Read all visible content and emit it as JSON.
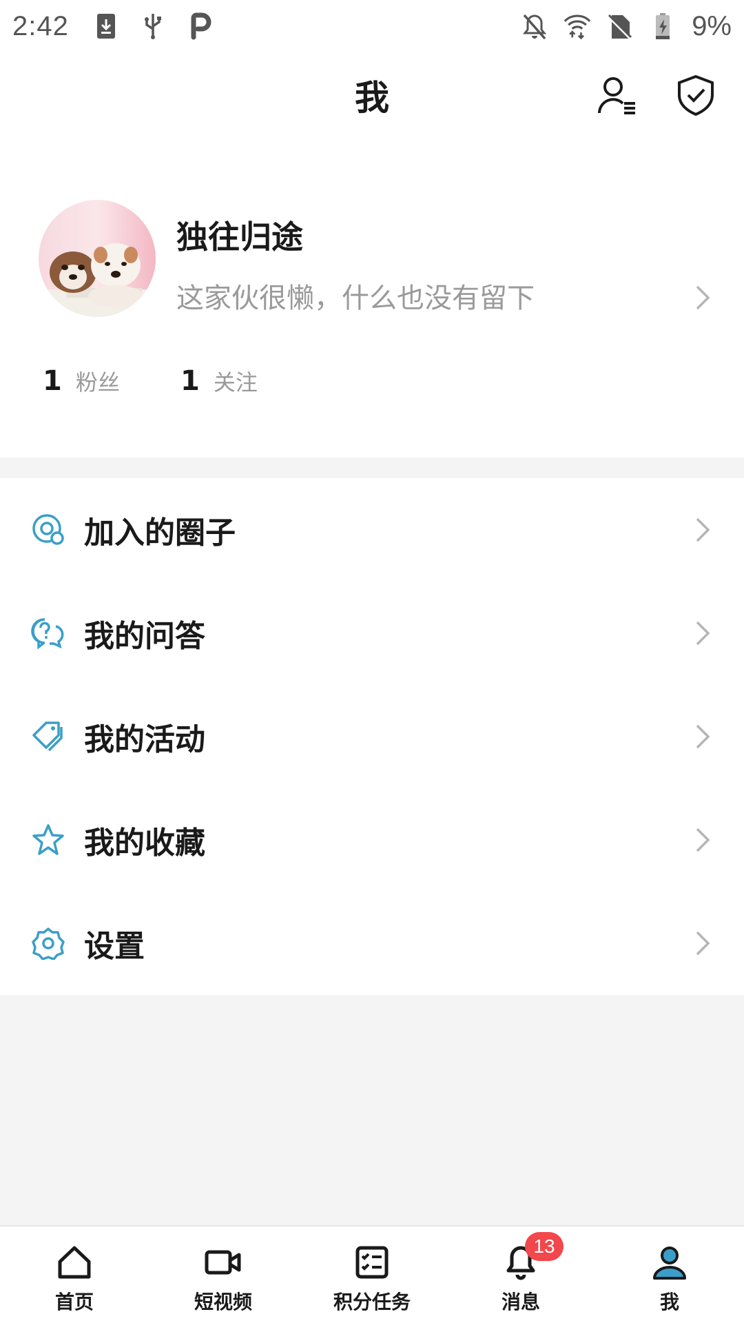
{
  "status_bar": {
    "time": "2:42",
    "battery": "9%",
    "left_icons": [
      "download-icon",
      "usb-icon",
      "p-app-icon"
    ],
    "right_icons": [
      "notifications-off-icon",
      "wifi-icon",
      "no-sim-icon",
      "battery-charging-icon"
    ]
  },
  "header": {
    "title": "我",
    "right_icons": [
      "user-list-icon",
      "shield-check-icon"
    ]
  },
  "profile": {
    "name": "独往归途",
    "bio": "这家伙很懒，什么也没有留下",
    "avatar": "avatar-puppies"
  },
  "stats": {
    "fans_count": "1",
    "fans_label": "粉丝",
    "follows_count": "1",
    "follows_label": "关注"
  },
  "menu": {
    "items": [
      {
        "label": "加入的圈子",
        "icon": "circle-group-icon"
      },
      {
        "label": "我的问答",
        "icon": "qa-bubble-icon"
      },
      {
        "label": "我的活动",
        "icon": "tag-icon"
      },
      {
        "label": "我的收藏",
        "icon": "star-icon"
      },
      {
        "label": "设置",
        "icon": "settings-gear-icon"
      }
    ]
  },
  "bottom_nav": {
    "items": [
      {
        "label": "首页",
        "icon": "home-icon"
      },
      {
        "label": "短视频",
        "icon": "video-camera-icon"
      },
      {
        "label": "积分任务",
        "icon": "task-list-icon"
      },
      {
        "label": "消息",
        "icon": "bell-icon",
        "badge": "13"
      },
      {
        "label": "我",
        "icon": "person-icon",
        "active": true
      }
    ]
  },
  "colors": {
    "accent": "#3a9ec9",
    "badge": "#f2474b",
    "muted_text": "#9a9a9a",
    "background_gray": "#f4f4f4"
  }
}
